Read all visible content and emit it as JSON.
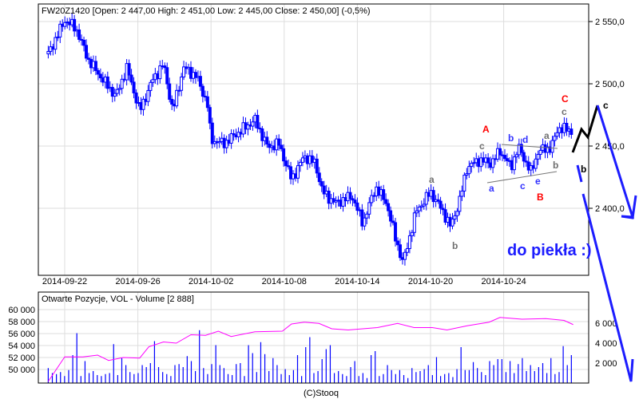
{
  "chart_data": [
    {
      "type": "line",
      "title": "FW20Z1420 [Open: 2 447,00  High: 2 451,00  Low: 2 445,00  Close: 2 450,00] (-0,5%)",
      "x_unit": "trading days since 2014-09-22",
      "x_ticks": [
        {
          "t": 0,
          "label": "2014-09-22"
        },
        {
          "t": 4,
          "label": "2014-09-26"
        },
        {
          "t": 8,
          "label": "2014-10-02"
        },
        {
          "t": 12,
          "label": "2014-10-08"
        },
        {
          "t": 16,
          "label": "2014-10-14"
        },
        {
          "t": 20,
          "label": "2014-10-20"
        },
        {
          "t": 24,
          "label": "2014-10-24"
        }
      ],
      "y_ticks": [
        {
          "v": 2550,
          "label": "2 550,0"
        },
        {
          "v": 2500,
          "label": "2 500,0"
        },
        {
          "v": 2450,
          "label": "2 450,0"
        },
        {
          "v": 2400,
          "label": "2 400,0"
        }
      ],
      "ylim": [
        2335,
        2567
      ],
      "grid": true,
      "series_color": "#0000ff",
      "price": [
        [
          -0.9,
          2524
        ],
        [
          0,
          2551
        ],
        [
          0.6,
          2545
        ],
        [
          1.3,
          2519
        ],
        [
          2.1,
          2503
        ],
        [
          2.8,
          2490
        ],
        [
          3.4,
          2513
        ],
        [
          4.1,
          2478
        ],
        [
          4.8,
          2503
        ],
        [
          5.4,
          2516
        ],
        [
          5.9,
          2478
        ],
        [
          6.5,
          2513
        ],
        [
          7.2,
          2506
        ],
        [
          7.8,
          2484
        ],
        [
          8.0,
          2455
        ],
        [
          8.7,
          2452
        ],
        [
          9.6,
          2462
        ],
        [
          10.4,
          2471
        ],
        [
          11.1,
          2449
        ],
        [
          11.7,
          2452
        ],
        [
          12.4,
          2423
        ],
        [
          13.1,
          2442
        ],
        [
          13.7,
          2436
        ],
        [
          14.1,
          2413
        ],
        [
          14.8,
          2404
        ],
        [
          15.7,
          2410
        ],
        [
          16.3,
          2388
        ],
        [
          17.0,
          2417
        ],
        [
          17.6,
          2404
        ],
        [
          18.1,
          2375
        ],
        [
          18.5,
          2356
        ],
        [
          19.2,
          2397
        ],
        [
          20.0,
          2413
        ],
        [
          20.7,
          2397
        ],
        [
          21.1,
          2385
        ],
        [
          21.6,
          2407
        ],
        [
          22.0,
          2433
        ],
        [
          22.7,
          2439
        ],
        [
          23.3,
          2436
        ],
        [
          23.8,
          2446
        ],
        [
          24.4,
          2433
        ],
        [
          24.8,
          2449
        ],
        [
          25.5,
          2429
        ],
        [
          25.9,
          2446
        ],
        [
          26.6,
          2449
        ],
        [
          27.0,
          2465
        ],
        [
          27.7,
          2462
        ]
      ],
      "annotations": [
        {
          "text": "a",
          "color": "#707070"
        },
        {
          "text": "b",
          "color": "#707070"
        },
        {
          "text": "c",
          "color": "#707070"
        },
        {
          "text": "A",
          "color": "#ff0000"
        },
        {
          "text": "a",
          "color": "#3333ff"
        },
        {
          "text": "b",
          "color": "#3333ff"
        },
        {
          "text": "c",
          "color": "#3333ff"
        },
        {
          "text": "d",
          "color": "#3333ff"
        },
        {
          "text": "e",
          "color": "#3333ff"
        },
        {
          "text": "B",
          "color": "#ff0000"
        },
        {
          "text": "a",
          "color": "#707070"
        },
        {
          "text": "b",
          "color": "#707070"
        },
        {
          "text": "c",
          "color": "#707070"
        },
        {
          "text": "C",
          "color": "#ff0000"
        },
        {
          "text": "c",
          "color": "#000000"
        },
        {
          "text": "b",
          "color": "#000000"
        }
      ],
      "forecast_label": "do piekła :)"
    },
    {
      "type": "bar",
      "title": "Otwarte Pozycje, VOL - Volume [2 888]",
      "left_ticks": [
        {
          "v": 60000,
          "label": "60 000"
        },
        {
          "v": 58000,
          "label": "58 000"
        },
        {
          "v": 56000,
          "label": "56 000"
        },
        {
          "v": 54000,
          "label": "54 000"
        },
        {
          "v": 52000,
          "label": "52 000"
        },
        {
          "v": 50000,
          "label": "50 000"
        }
      ],
      "right_ticks": [
        {
          "v": 6000,
          "label": "6 000"
        },
        {
          "v": 4000,
          "label": "4 000"
        },
        {
          "v": 2000,
          "label": "2 000"
        }
      ],
      "volume_color": "#0000ff",
      "oi_color": "#ff00ff",
      "volume": [
        1500,
        1000,
        900,
        1100,
        700,
        1300,
        2800,
        5000,
        700,
        2200,
        1000,
        1200,
        800,
        700,
        900,
        1000,
        3900,
        800,
        2500,
        1800,
        1100,
        900,
        1000,
        1800,
        1600,
        2000,
        4200,
        1600,
        1100,
        900,
        700,
        1800,
        1900,
        1600,
        2700,
        2200,
        1200,
        5300,
        1500,
        900,
        1900,
        3800,
        1800,
        1500,
        900,
        800,
        1900,
        2000,
        700,
        3800,
        3000,
        1100,
        4100,
        2900,
        1200,
        2500,
        1800,
        900,
        1400,
        800,
        1300,
        2800,
        700,
        3600,
        4600,
        1000,
        1200,
        2400,
        3400,
        3800,
        1000,
        1200,
        900,
        700,
        1600,
        2200,
        700,
        1000,
        500,
        2800,
        3200,
        700,
        900,
        1800,
        1300,
        900,
        1300,
        800,
        500,
        1500,
        1100,
        1200,
        1400,
        1800,
        800,
        2600,
        700,
        900,
        1000,
        600,
        1400,
        3600,
        1300,
        1300,
        2100,
        1500,
        1100,
        800,
        2200,
        1800,
        2400,
        2400,
        1100,
        2200,
        1000,
        1900,
        2500,
        1200,
        1800,
        1200,
        1600,
        2000,
        1000,
        2500,
        900,
        1100,
        3700,
        1800,
        2800
      ],
      "open_interest": [
        [
          -0.9,
          48000
        ],
        [
          0,
          52100
        ],
        [
          1,
          52100
        ],
        [
          1.8,
          52400
        ],
        [
          2.4,
          51500
        ],
        [
          3.2,
          52000
        ],
        [
          4.1,
          51900
        ],
        [
          4.6,
          53800
        ],
        [
          5.4,
          54600
        ],
        [
          6.1,
          54400
        ],
        [
          6.9,
          55800
        ],
        [
          7.7,
          55700
        ],
        [
          8.4,
          56400
        ],
        [
          9.1,
          55500
        ],
        [
          10.4,
          56300
        ],
        [
          11.9,
          56400
        ],
        [
          12.4,
          57600
        ],
        [
          13.1,
          57900
        ],
        [
          13.9,
          57700
        ],
        [
          14.6,
          56800
        ],
        [
          15.5,
          56600
        ],
        [
          17.1,
          57000
        ],
        [
          18.2,
          57700
        ],
        [
          19.1,
          57000
        ],
        [
          20.1,
          57000
        ],
        [
          20.9,
          56600
        ],
        [
          22.0,
          57300
        ],
        [
          23.2,
          57900
        ],
        [
          23.8,
          58700
        ],
        [
          25.0,
          58400
        ],
        [
          26.3,
          58500
        ],
        [
          27.3,
          58200
        ],
        [
          27.8,
          57500
        ]
      ],
      "left_ylim": [
        47200,
        62000
      ]
    }
  ],
  "footer": "(C)Stooq"
}
